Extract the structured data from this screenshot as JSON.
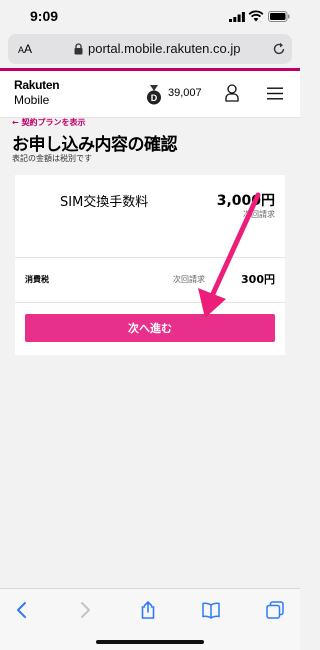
{
  "status": {
    "time": "9:09"
  },
  "browser": {
    "aa_small": "A",
    "aa_large": "A",
    "url": "portal.mobile.rakuten.co.jp"
  },
  "header": {
    "logo_line1": "Rakuten",
    "logo_line2": "Mobile",
    "points": "39,007"
  },
  "page": {
    "back_link": "← 契約プランを表示",
    "title": "お申し込み内容の確認",
    "note": "表記の金額は税別です"
  },
  "order": {
    "item_name": "SIM交換手数料",
    "item_price": "3,000円",
    "item_sub": "次回請求",
    "tax_label": "消費税",
    "tax_sub": "次回請求",
    "tax_price": "300円"
  },
  "actions": {
    "next_label": "次へ進む"
  },
  "colors": {
    "brand": "#bf0068",
    "button": "#e8308a",
    "arrow": "#ec1e79"
  },
  "icons": [
    "signal-icon",
    "wifi-icon",
    "battery-icon",
    "lock-icon",
    "reload-icon",
    "medal-icon",
    "user-icon",
    "hamburger-menu-icon",
    "back-icon",
    "forward-icon",
    "share-icon",
    "bookmarks-icon",
    "tabs-icon"
  ]
}
